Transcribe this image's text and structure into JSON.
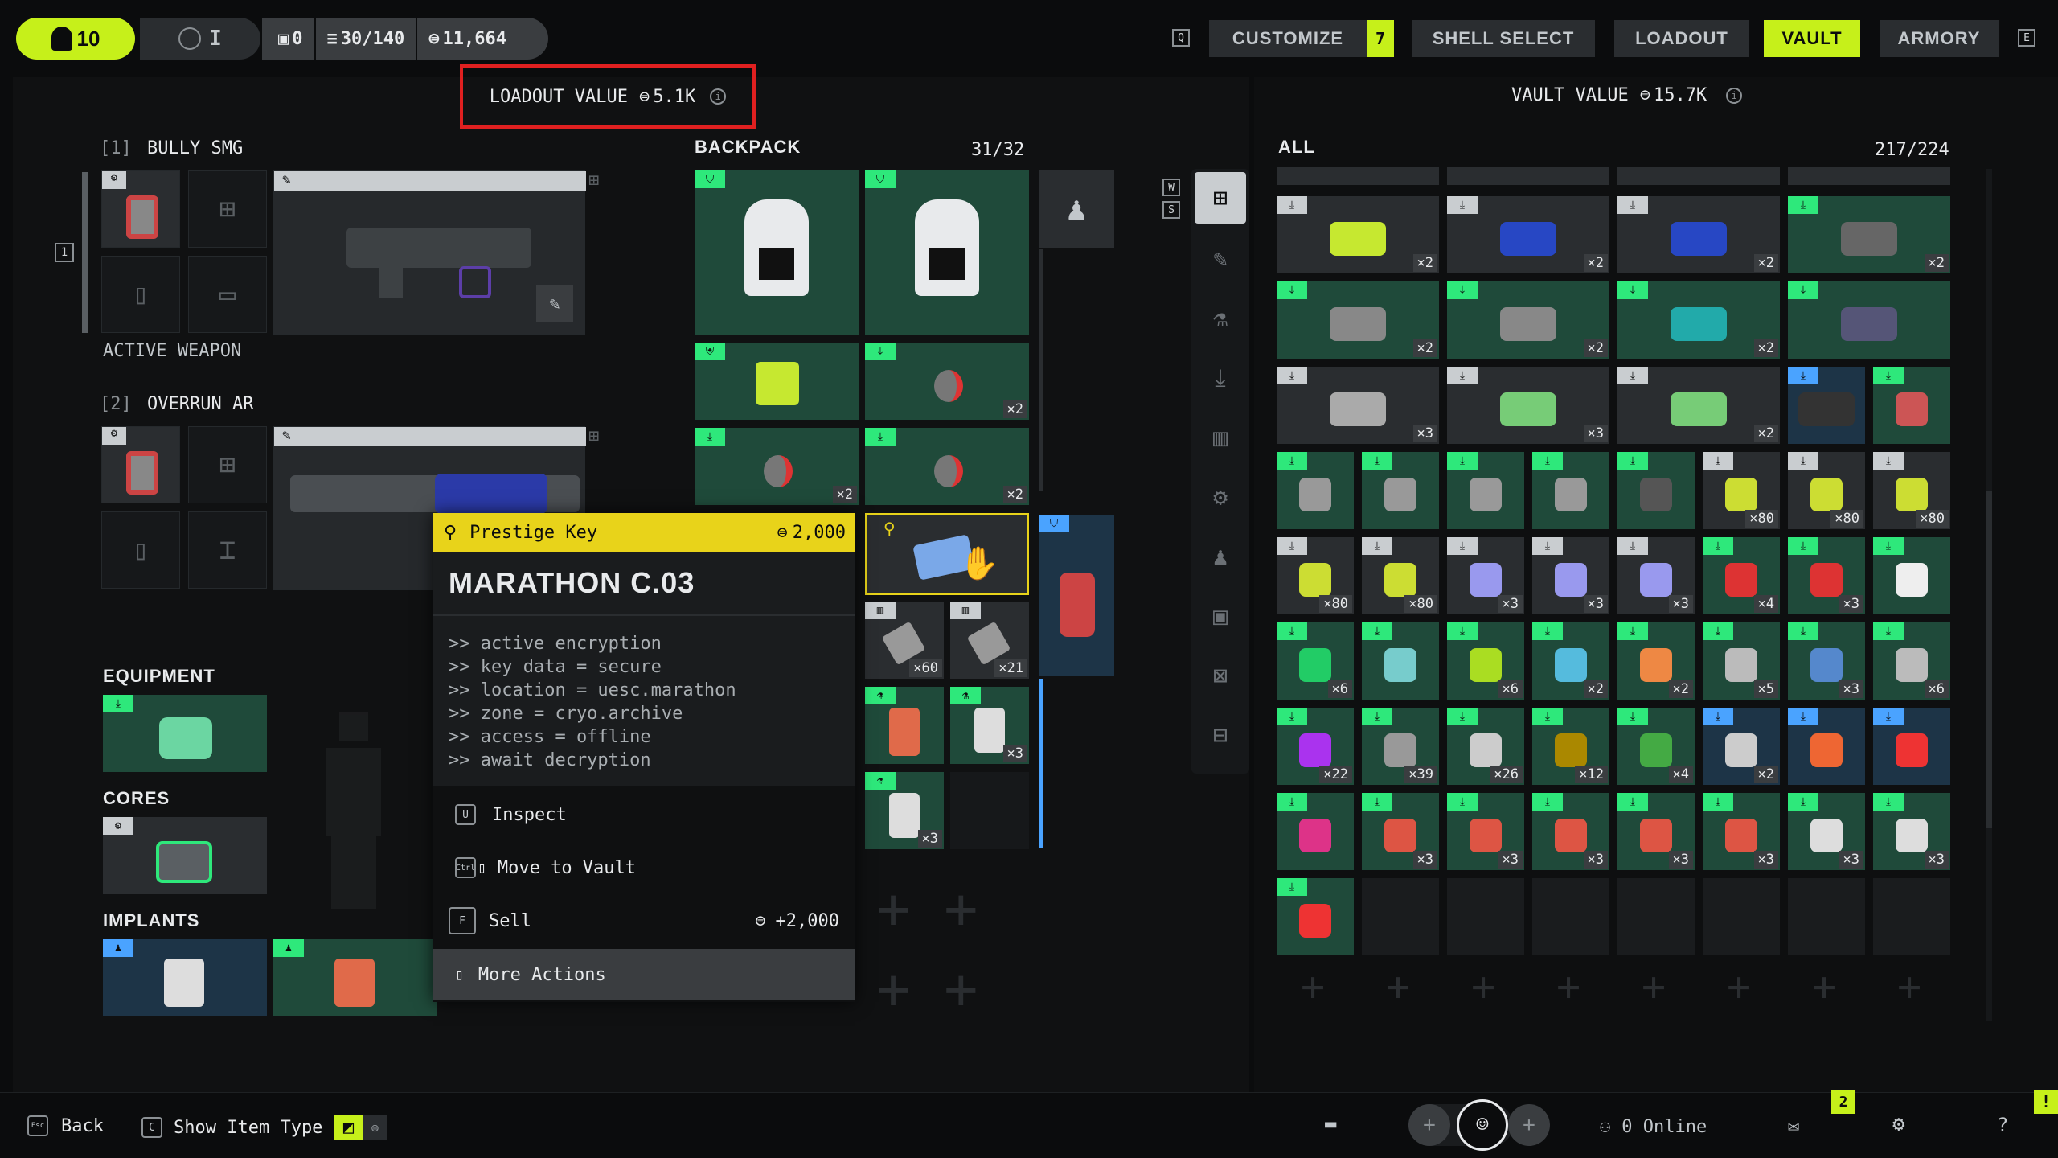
{
  "topbar": {
    "level": "10",
    "rank": "I",
    "badge_count": "0",
    "capacity": "30/140",
    "credits": "11,664",
    "q_key": "Q",
    "e_key": "E",
    "nav": [
      {
        "label": "CUSTOMIZE",
        "active": false
      },
      {
        "label": "SHELL SELECT",
        "active": false
      },
      {
        "label": "LOADOUT",
        "active": false
      },
      {
        "label": "VAULT",
        "active": true
      },
      {
        "label": "ARMORY",
        "active": false
      }
    ],
    "customize_badge": "7"
  },
  "loadout": {
    "value_label": "LOADOUT VALUE",
    "value": "5.1K",
    "weapon1_slot": "[1]",
    "weapon1_name": "BULLY SMG",
    "weapon1_status": "ACTIVE WEAPON",
    "weapon2_slot": "[2]",
    "weapon2_name": "OVERRUN AR",
    "active_index": "1",
    "equipment_label": "EQUIPMENT",
    "cores_label": "CORES",
    "implants_label": "IMPLANTS"
  },
  "backpack": {
    "title": "BACKPACK",
    "count": "31/32",
    "w_key": "W",
    "s_key": "S",
    "counts": [
      "×2",
      "×2",
      "×2",
      "×60",
      "×21",
      "×3",
      "×3"
    ]
  },
  "tooltip": {
    "type": "Prestige Key",
    "price": "2,000",
    "name": "MARATHON C.03",
    "lines": [
      ">> active encryption",
      ">> key data = secure",
      ">> location = uesc.marathon",
      ">> zone = cryo.archive",
      ">> access = offline",
      ">> await decryption"
    ],
    "inspect_key": "U",
    "inspect": "Inspect",
    "move_key": "Ctrl",
    "move": "Move to Vault",
    "sell_key": "F",
    "sell": "Sell",
    "sell_value": "+2,000",
    "more": "More Actions"
  },
  "vault": {
    "value_label": "VAULT VALUE",
    "value": "15.7K",
    "filter": "ALL",
    "count": "217/224",
    "rows": [
      [
        {
          "t": "gray",
          "c": "×2",
          "col": "#c6e830"
        },
        {
          "t": "gray",
          "c": "×2",
          "col": "#2747c4"
        },
        {
          "t": "gray",
          "c": "×2",
          "col": "#2747c4"
        },
        {
          "t": "green",
          "c": "×2",
          "col": "#666"
        }
      ],
      [
        {
          "t": "green",
          "c": "×2",
          "col": "#888"
        },
        {
          "t": "green",
          "c": "×2",
          "col": "#888"
        },
        {
          "t": "green",
          "c": "×2",
          "col": "#2aa"
        },
        {
          "t": "green",
          "c": "",
          "col": "#557"
        }
      ],
      [
        {
          "t": "gray",
          "c": "×3",
          "col": "#aaa"
        },
        {
          "t": "gray",
          "c": "×3",
          "col": "#7c7"
        },
        {
          "t": "gray",
          "c": "×2",
          "col": "#7c7"
        },
        {
          "t": "blue",
          "c": "",
          "col": "#333"
        },
        {
          "t": "green",
          "c": "",
          "col": "#c55"
        }
      ],
      [
        {
          "t": "green",
          "c": "",
          "col": "#999"
        },
        {
          "t": "green",
          "c": "",
          "col": "#999"
        },
        {
          "t": "green",
          "c": "",
          "col": "#999"
        },
        {
          "t": "green",
          "c": "",
          "col": "#999"
        },
        {
          "t": "green",
          "c": "",
          "col": "#555"
        },
        {
          "t": "gray",
          "c": "×80",
          "col": "#cd3"
        },
        {
          "t": "gray",
          "c": "×80",
          "col": "#cd3"
        },
        {
          "t": "gray",
          "c": "×80",
          "col": "#cd3"
        }
      ],
      [
        {
          "t": "gray",
          "c": "×80",
          "col": "#cd3"
        },
        {
          "t": "gray",
          "c": "×80",
          "col": "#cd3"
        },
        {
          "t": "gray",
          "c": "×3",
          "col": "#99e"
        },
        {
          "t": "gray",
          "c": "×3",
          "col": "#99e"
        },
        {
          "t": "gray",
          "c": "×3",
          "col": "#99e"
        },
        {
          "t": "green",
          "c": "×4",
          "col": "#d33"
        },
        {
          "t": "green",
          "c": "×3",
          "col": "#d33"
        },
        {
          "t": "green",
          "c": "",
          "col": "#eee"
        }
      ],
      [
        {
          "t": "green",
          "c": "×6",
          "col": "#2c6"
        },
        {
          "t": "green",
          "c": "",
          "col": "#7cc"
        },
        {
          "t": "green",
          "c": "×6",
          "col": "#ad2"
        },
        {
          "t": "green",
          "c": "×2",
          "col": "#5bd"
        },
        {
          "t": "green",
          "c": "×2",
          "col": "#e84"
        },
        {
          "t": "green",
          "c": "×5",
          "col": "#bbb"
        },
        {
          "t": "green",
          "c": "×3",
          "col": "#58c"
        },
        {
          "t": "green",
          "c": "×6",
          "col": "#bbb"
        }
      ],
      [
        {
          "t": "green",
          "c": "×22",
          "col": "#a3e"
        },
        {
          "t": "green",
          "c": "×39",
          "col": "#999"
        },
        {
          "t": "green",
          "c": "×26",
          "col": "#ccc"
        },
        {
          "t": "green",
          "c": "×12",
          "col": "#a80"
        },
        {
          "t": "green",
          "c": "×4",
          "col": "#4a4"
        },
        {
          "t": "blue",
          "c": "×2",
          "col": "#ccc"
        },
        {
          "t": "blue",
          "c": "",
          "col": "#e63"
        },
        {
          "t": "blue",
          "c": "",
          "col": "#e33"
        }
      ],
      [
        {
          "t": "green",
          "c": "",
          "col": "#d38"
        },
        {
          "t": "green",
          "c": "×3",
          "col": "#d54"
        },
        {
          "t": "green",
          "c": "×3",
          "col": "#d54"
        },
        {
          "t": "green",
          "c": "×3",
          "col": "#d54"
        },
        {
          "t": "green",
          "c": "×3",
          "col": "#d54"
        },
        {
          "t": "green",
          "c": "×3",
          "col": "#d54"
        },
        {
          "t": "green",
          "c": "×3",
          "col": "#ddd"
        },
        {
          "t": "green",
          "c": "×3",
          "col": "#ddd"
        }
      ],
      [
        {
          "t": "green",
          "c": "",
          "col": "#e33"
        },
        {
          "t": "empty",
          "c": "",
          "col": ""
        },
        {
          "t": "empty",
          "c": "",
          "col": ""
        },
        {
          "t": "empty",
          "c": "",
          "col": ""
        },
        {
          "t": "empty",
          "c": "",
          "col": ""
        },
        {
          "t": "empty",
          "c": "",
          "col": ""
        },
        {
          "t": "empty",
          "c": "",
          "col": ""
        },
        {
          "t": "empty",
          "c": "",
          "col": ""
        }
      ]
    ]
  },
  "bottombar": {
    "back_key": "Esc",
    "back": "Back",
    "show_key": "C",
    "show": "Show Item Type",
    "online": "0 Online",
    "mail_badge": "2",
    "help": "?",
    "alert": "!"
  },
  "colors": {
    "accent": "#c6f01a",
    "highlight": "#e8d31a",
    "green": "#2ee87b",
    "blue": "#4aa3ff",
    "red": "#e02020"
  }
}
